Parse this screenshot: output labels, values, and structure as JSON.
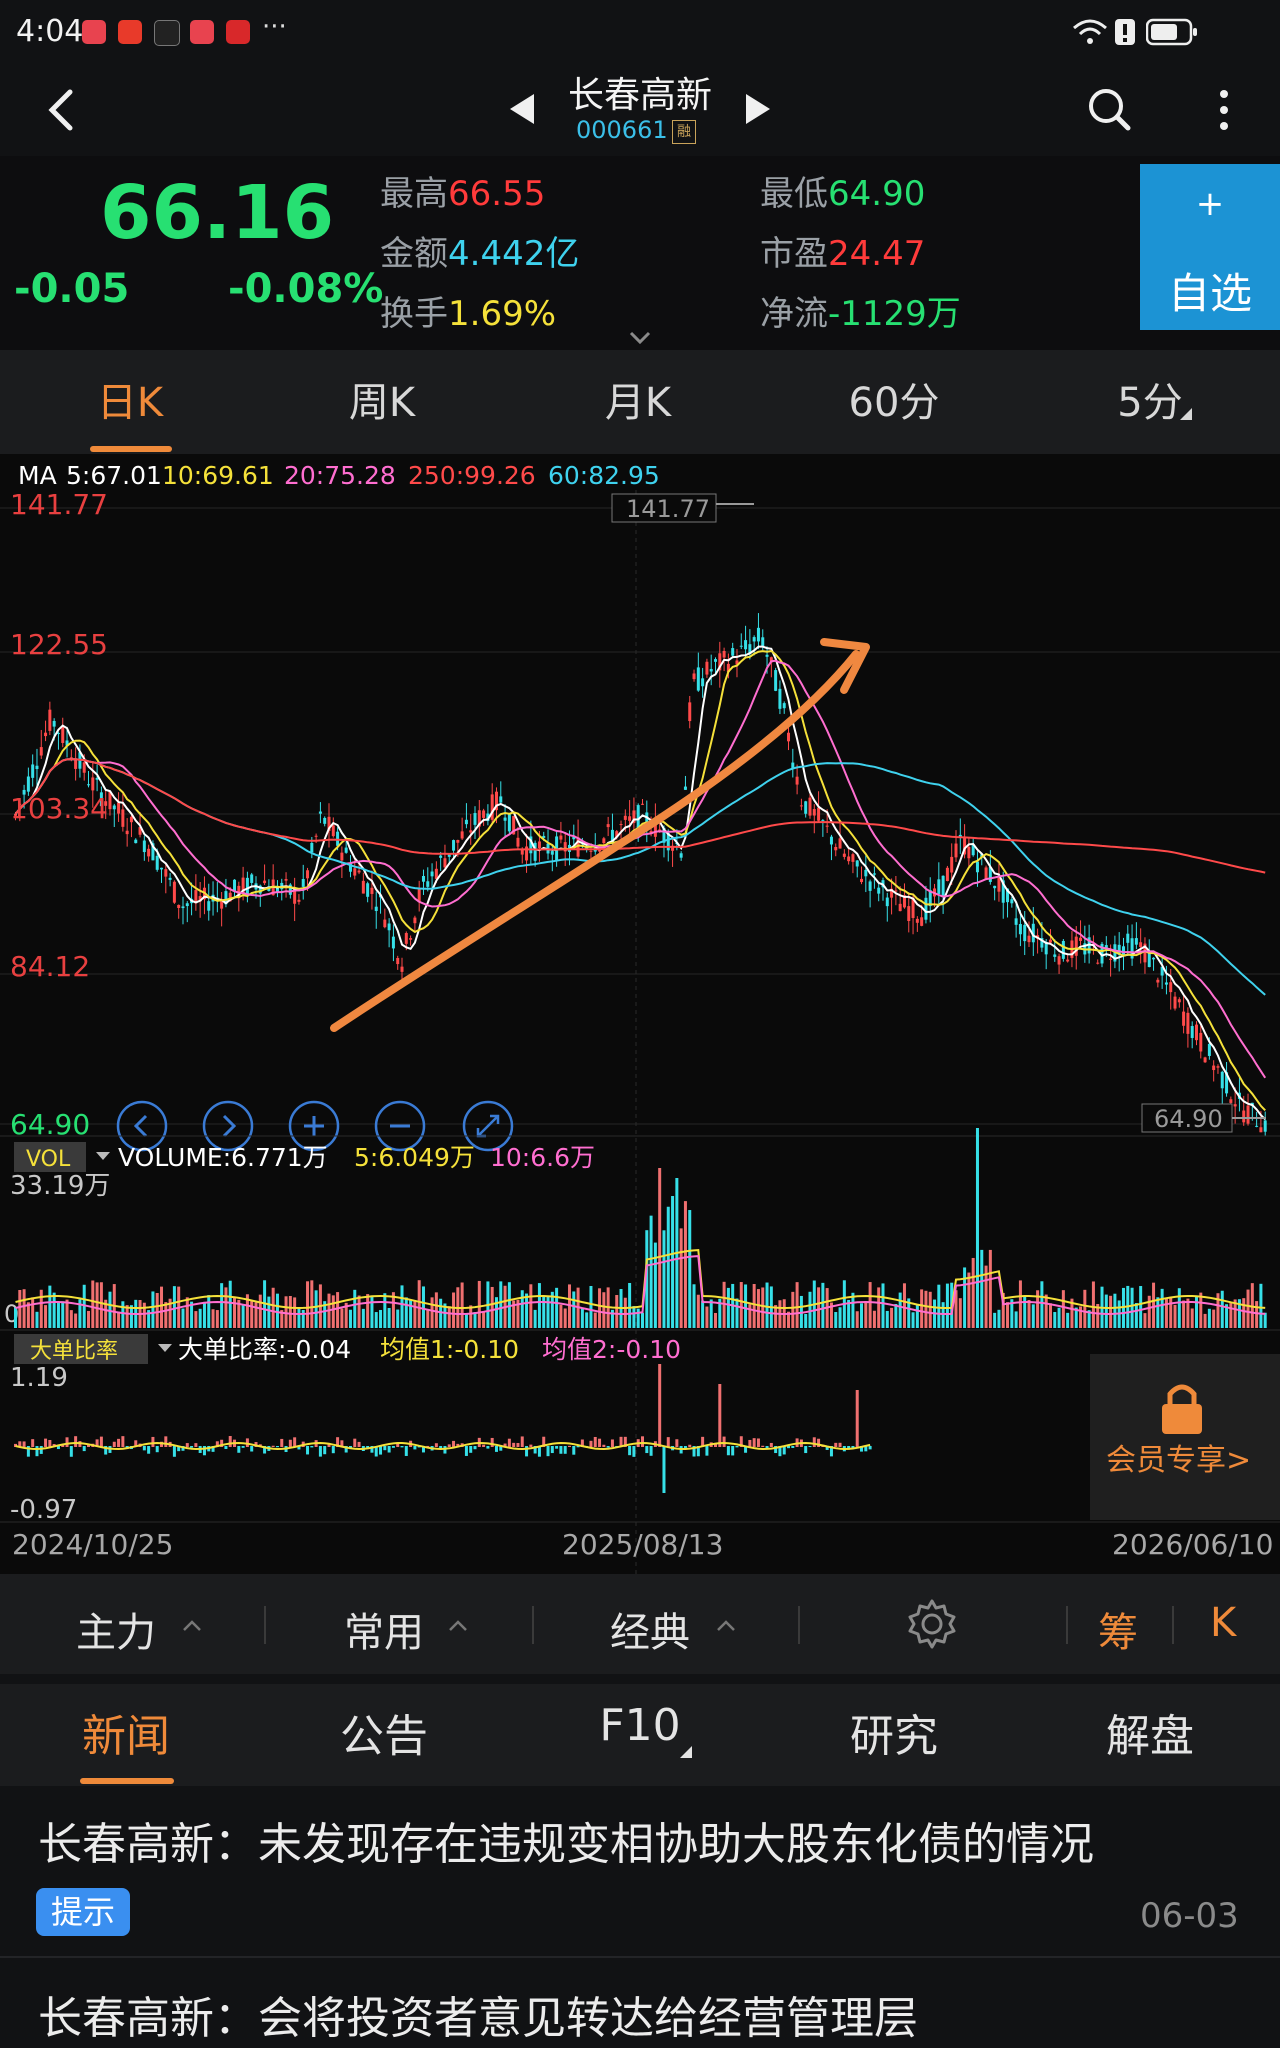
{
  "status_bar": {
    "time": "4:04",
    "more": "···"
  },
  "header": {
    "title": "长春高新",
    "code": "000661",
    "rong": "融"
  },
  "quote": {
    "price": "66.16",
    "change": "-0.05",
    "change_pct": "-0.08%",
    "stats": [
      {
        "label": "最高",
        "value": "66.55",
        "color": "#ff3b3b"
      },
      {
        "label": "金额",
        "value": "4.442亿",
        "color": "#3fd2ee"
      },
      {
        "label": "换手",
        "value": "1.69%",
        "color": "#f5e13a"
      },
      {
        "label": "最低",
        "value": "64.90",
        "color": "#27e072"
      },
      {
        "label": "市盈",
        "value": "24.47",
        "color": "#ff3b3b"
      },
      {
        "label": "净流",
        "value": "-1129万",
        "color": "#27e072"
      }
    ],
    "watch": {
      "plus": "+",
      "label": "自选"
    }
  },
  "period_tabs": [
    "日K",
    "周K",
    "月K",
    "60分",
    "5分"
  ],
  "chart": {
    "ma_legend": [
      {
        "text": "MA",
        "color": "#ffffff"
      },
      {
        "text": "5:67.01",
        "color": "#ffffff"
      },
      {
        "text": "10:69.61",
        "color": "#f5e13a"
      },
      {
        "text": "20:75.28",
        "color": "#ff6ed0"
      },
      {
        "text": "250:99.26",
        "color": "#ff4a4a"
      },
      {
        "text": "60:82.95",
        "color": "#3fd2ee"
      }
    ],
    "price_axis": [
      "141.77",
      "122.55",
      "103.34",
      "84.12",
      "64.90"
    ],
    "price_high_label": "141.77",
    "price_low_label": "64.90",
    "vol_tag": "VOL",
    "vol_legend": [
      {
        "text": "VOLUME:6.771万",
        "color": "#ffffff"
      },
      {
        "text": "5:6.049万",
        "color": "#f5e13a"
      },
      {
        "text": "10:6.6万",
        "color": "#ff6ed0"
      }
    ],
    "vol_axis_top": "33.19万",
    "vol_axis_zero": "0",
    "ratio_tag": "大单比率",
    "ratio_legend": [
      {
        "text": "大单比率:-0.04",
        "color": "#ffffff"
      },
      {
        "text": "均值1:-0.10",
        "color": "#f5e13a"
      },
      {
        "text": "均值2:-0.10",
        "color": "#ff6ed0"
      }
    ],
    "ratio_axis": [
      "1.19",
      "-0.97"
    ],
    "member_label": "会员专享>",
    "dates": [
      "2024/10/25",
      "2025/08/13",
      "2026/06/10"
    ],
    "controls": [
      "left-icon",
      "right-icon",
      "zoom-in-icon",
      "zoom-out-icon",
      "fullscreen-icon"
    ]
  },
  "toolbar": {
    "items": [
      "主力",
      "常用",
      "经典"
    ],
    "chou": "筹",
    "k": "K"
  },
  "news_tabs": [
    "新闻",
    "公告",
    "F10",
    "研究",
    "解盘"
  ],
  "news": [
    {
      "title": "长春高新：未发现存在违规变相协助大股东化债的情况",
      "tag": "提示",
      "date": "06-03"
    },
    {
      "title": "长春高新：会将投资者意见转达给经营管理层"
    }
  ],
  "colors": {
    "accent": "#ef8a3a",
    "up": "#ff4a4a",
    "down": "#27e072",
    "cyan": "#3fd2ee",
    "watch_bg": "#1c93d4"
  }
}
